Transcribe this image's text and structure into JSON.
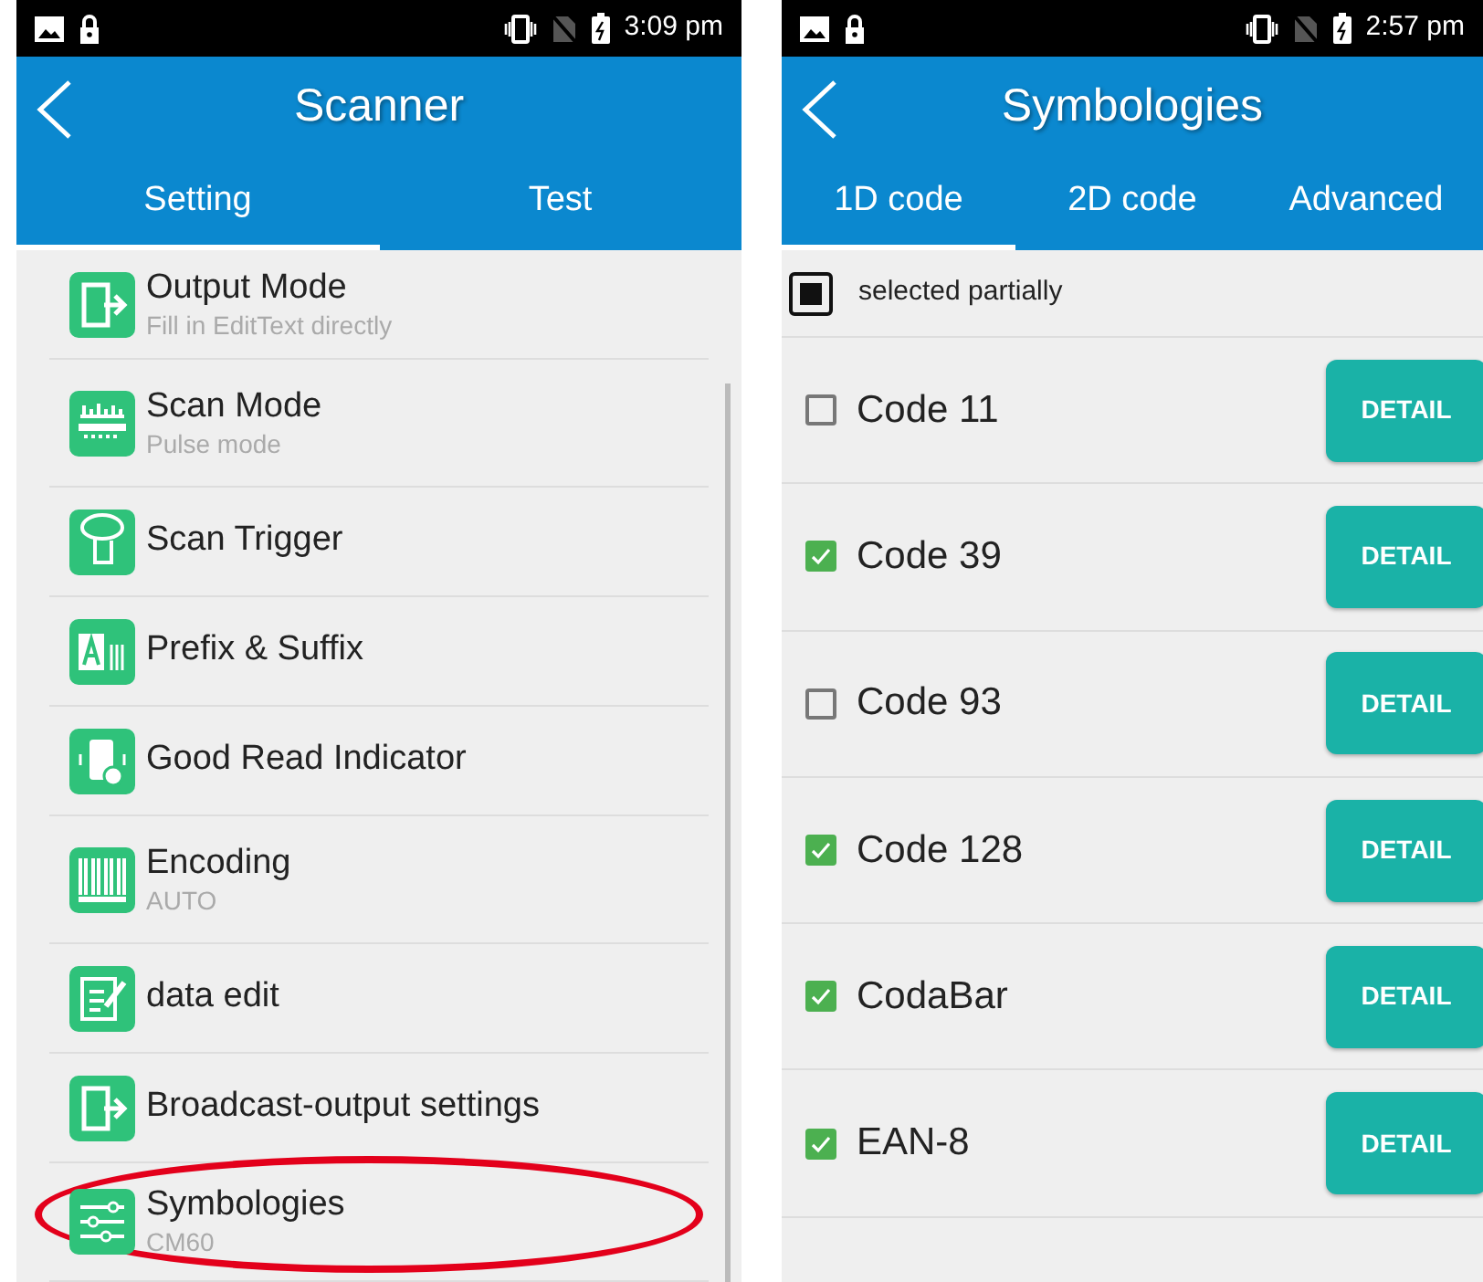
{
  "screens": [
    {
      "status_bar": {
        "time": "3:09 pm"
      },
      "title": "Scanner",
      "tabs": [
        {
          "label": "Setting",
          "selected": true
        },
        {
          "label": "Test",
          "selected": false
        }
      ],
      "settings": [
        {
          "kind": "output",
          "title": "Output Mode",
          "subtitle": "Fill in EditText directly",
          "circled": false
        },
        {
          "kind": "scanmode",
          "title": "Scan Mode",
          "subtitle": "Pulse mode",
          "circled": false
        },
        {
          "kind": "trigger",
          "title": "Scan Trigger",
          "circled": false
        },
        {
          "kind": "prefix",
          "title": "Prefix & Suffix",
          "circled": false
        },
        {
          "kind": "indicator",
          "title": "Good Read Indicator",
          "circled": false
        },
        {
          "kind": "barcode",
          "title": "Encoding",
          "subtitle": "AUTO",
          "circled": false
        },
        {
          "kind": "edit",
          "title": "data edit",
          "circled": false
        },
        {
          "kind": "output",
          "title": "Broadcast-output settings",
          "circled": false
        },
        {
          "kind": "sliders",
          "title": "Symbologies",
          "subtitle": "CM60",
          "circled": true
        }
      ]
    },
    {
      "status_bar": {
        "time": "2:57 pm"
      },
      "title": "Symbologies",
      "tabs": [
        {
          "label": "1D code",
          "selected": true
        },
        {
          "label": "2D code",
          "selected": false
        },
        {
          "label": "Advanced",
          "selected": false
        }
      ],
      "select_all": {
        "label": "selected partially",
        "partial": true
      },
      "codes": [
        {
          "label": "Code 11",
          "checked": false,
          "button": "DETAIL"
        },
        {
          "label": "Code 39",
          "checked": true,
          "button": "DETAIL"
        },
        {
          "label": "Code 93",
          "checked": false,
          "button": "DETAIL"
        },
        {
          "label": "Code 128",
          "checked": true,
          "button": "DETAIL"
        },
        {
          "label": "CodaBar",
          "checked": true,
          "button": "DETAIL"
        },
        {
          "label": "EAN-8",
          "checked": true,
          "button": "DETAIL"
        }
      ]
    }
  ]
}
